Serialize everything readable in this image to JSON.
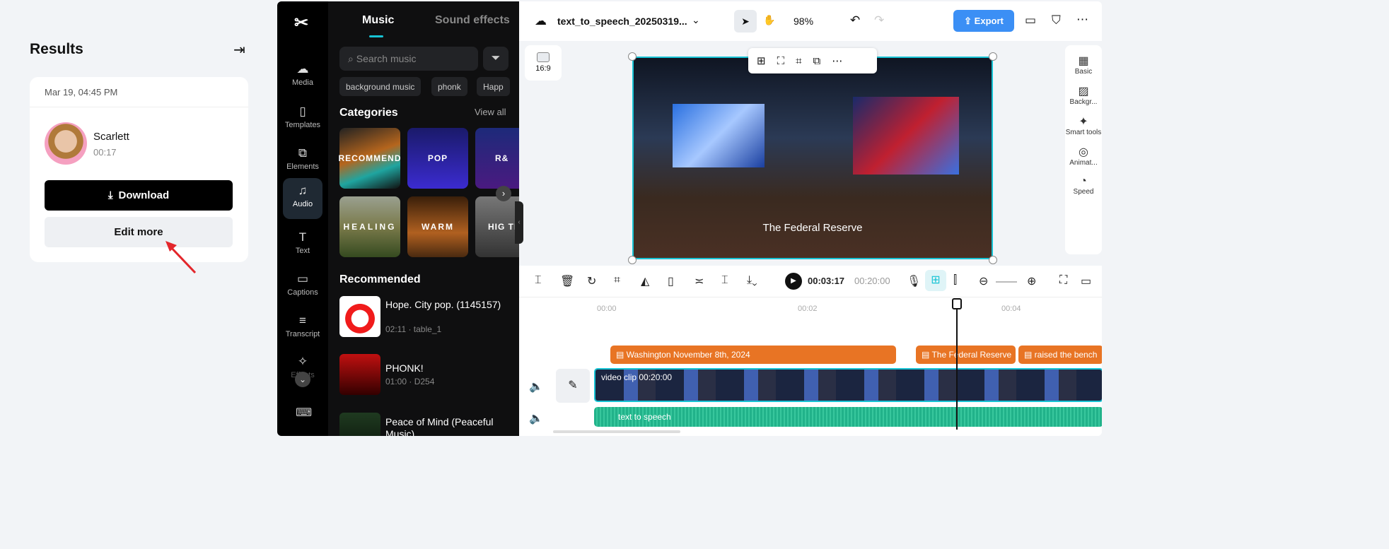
{
  "results": {
    "title": "Results",
    "date": "Mar 19, 04:45 PM",
    "voice_name": "Scarlett",
    "duration": "00:17",
    "download_label": "Download",
    "edit_label": "Edit more"
  },
  "nav": {
    "items": [
      {
        "label": "Media",
        "icon": "☁"
      },
      {
        "label": "Templates",
        "icon": "▯"
      },
      {
        "label": "Elements",
        "icon": "⧉"
      },
      {
        "label": "Audio",
        "icon": "♫"
      },
      {
        "label": "Text",
        "icon": "T"
      },
      {
        "label": "Captions",
        "icon": "▭"
      },
      {
        "label": "Transcript",
        "icon": "≡"
      },
      {
        "label": "Effects",
        "icon": "✧"
      }
    ]
  },
  "music": {
    "tabs": [
      "Music",
      "Sound effects"
    ],
    "search_placeholder": "Search music",
    "chips": [
      "background music",
      "phonk",
      "Happ"
    ],
    "categories_title": "Categories",
    "view_all": "View all",
    "categories": [
      "RECOMMEND",
      "POP",
      "R&",
      "HEALING",
      "WARM",
      "HIG TEM"
    ],
    "recommended_title": "Recommended",
    "songs": [
      {
        "title": "Hope. City pop. (1145157)",
        "meta": "02:11 · table_1"
      },
      {
        "title": "PHONK!",
        "meta": "01:00 · D254"
      },
      {
        "title": "Peace of Mind (Peaceful Music)",
        "meta": ""
      }
    ]
  },
  "topbar": {
    "project_name": "text_to_speech_20250319...",
    "zoom": "98%",
    "export_label": "Export"
  },
  "canvas": {
    "aspect": "16:9",
    "caption": "The Federal Reserve"
  },
  "playback": {
    "current": "00:03:17",
    "total": "00:20:00"
  },
  "timeline": {
    "ticks": [
      "00:00",
      "00:02",
      "00:04"
    ],
    "text_clips": [
      "Washington November 8th, 2024",
      "The Federal Reserve",
      "raised the bench"
    ],
    "video_clip": "video clip  00:20:00",
    "audio_clip": "text to speech"
  },
  "right_panel": [
    "Basic",
    "Backgr...",
    "Smart tools",
    "Animat...",
    "Speed"
  ],
  "colors": {
    "accent": "#17c3d4",
    "export": "#3b8ff5",
    "text_clip": "#e87424",
    "audio_clip": "#21b28a"
  }
}
